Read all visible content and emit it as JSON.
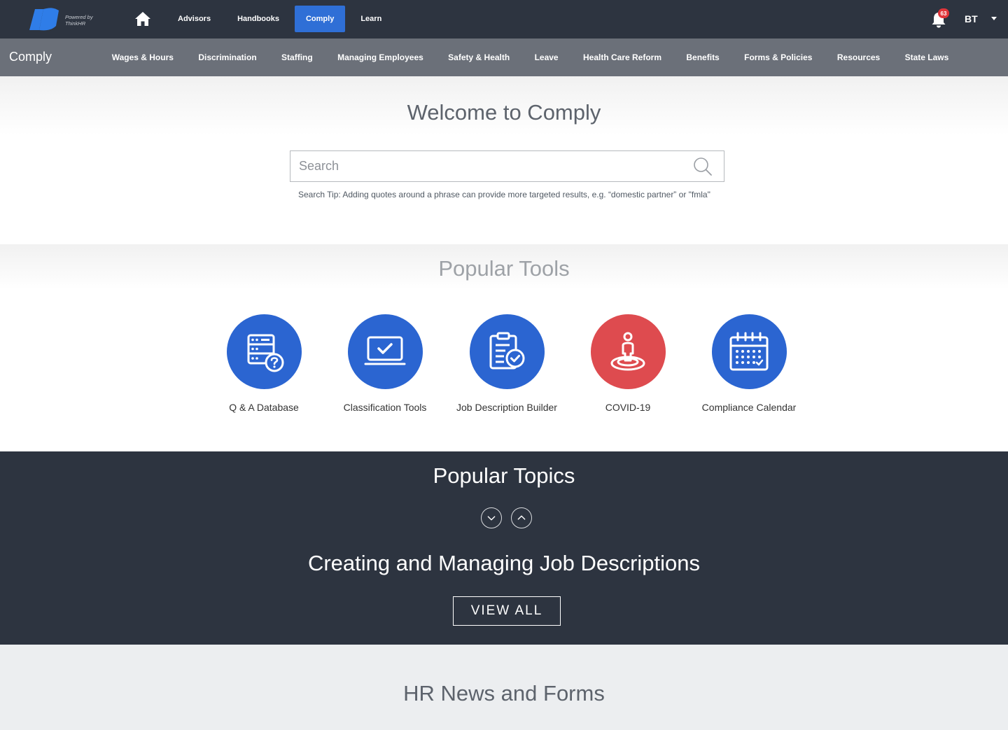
{
  "topbar": {
    "logo_caption": "Powered by ThinkHR",
    "nav": [
      {
        "label": "Advisors",
        "active": false
      },
      {
        "label": "Handbooks",
        "active": false
      },
      {
        "label": "Comply",
        "active": true
      },
      {
        "label": "Learn",
        "active": false
      }
    ],
    "notifications_count": "63",
    "user_initials": "BT",
    "colors": {
      "background": "#2d3440",
      "active": "#2f6fd6",
      "badge": "#e0353a"
    }
  },
  "subnav": {
    "title": "Comply",
    "items": [
      "Wages & Hours",
      "Discrimination",
      "Staffing",
      "Managing Employees",
      "Safety & Health",
      "Leave",
      "Health Care Reform",
      "Benefits",
      "Forms & Policies",
      "Resources",
      "State Laws"
    ]
  },
  "welcome": {
    "title": "Welcome to Comply",
    "search_placeholder": "Search",
    "search_value": "",
    "search_tip": "Search Tip: Adding quotes around a phrase can provide more targeted results, e.g. “domestic partner” or \"fmla\""
  },
  "tools": {
    "title": "Popular Tools",
    "items": [
      {
        "label": "Q & A Database",
        "icon": "database-question-icon",
        "color": "#2b65d1"
      },
      {
        "label": "Classification Tools",
        "icon": "laptop-check-icon",
        "color": "#2b65d1"
      },
      {
        "label": "Job Description Builder",
        "icon": "clipboard-check-icon",
        "color": "#2b65d1"
      },
      {
        "label": "COVID-19",
        "icon": "person-distance-icon",
        "color": "#de4b4f"
      },
      {
        "label": "Compliance Calendar",
        "icon": "calendar-icon",
        "color": "#2b65d1"
      }
    ]
  },
  "topics": {
    "title": "Popular Topics",
    "current_topic": "Creating and Managing Job Descriptions",
    "view_all_label": "VIEW ALL"
  },
  "news": {
    "title": "HR News and Forms"
  }
}
